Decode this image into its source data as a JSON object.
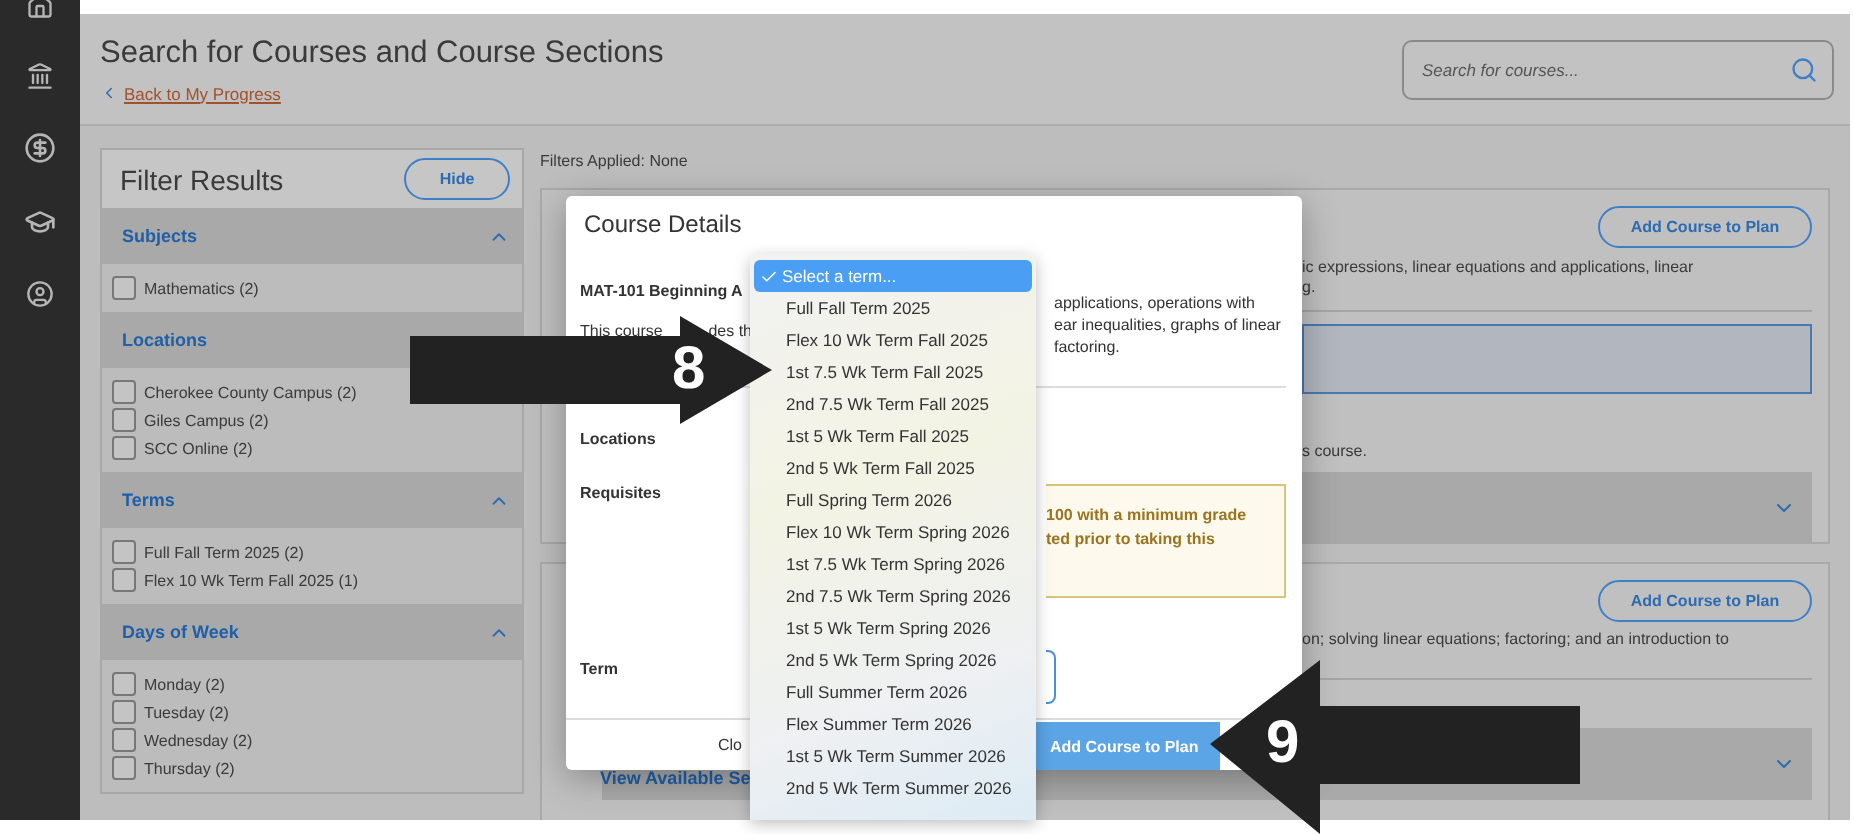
{
  "header": {
    "title": "Search for Courses and Course Sections",
    "back_link": "Back to My Progress",
    "search": {
      "placeholder": "Search for courses..."
    }
  },
  "filters": {
    "title": "Filter Results",
    "hide_button": "Hide",
    "sections": [
      {
        "title": "Subjects",
        "expanded": true,
        "options": [
          {
            "label": "Mathematics (2)",
            "checked": false
          }
        ]
      },
      {
        "title": "Locations",
        "options": [
          {
            "label": "Cherokee County Campus (2)",
            "checked": false
          },
          {
            "label": "Giles Campus (2)",
            "checked": false
          },
          {
            "label": "SCC Online (2)",
            "checked": false
          }
        ]
      },
      {
        "title": "Terms",
        "expanded": true,
        "options": [
          {
            "label": "Full Fall Term 2025 (2)",
            "checked": false
          },
          {
            "label": "Flex 10 Wk Term Fall 2025 (1)",
            "checked": false
          }
        ]
      },
      {
        "title": "Days of Week",
        "expanded": true,
        "options": [
          {
            "label": "Monday (2)",
            "checked": false
          },
          {
            "label": "Tuesday (2)",
            "checked": false
          },
          {
            "label": "Wednesday (2)",
            "checked": false
          },
          {
            "label": "Thursday (2)",
            "checked": false
          }
        ]
      }
    ]
  },
  "filters_applied": "Filters Applied: None",
  "results": [
    {
      "button": "Add Course to Plan",
      "text_lines": [
        "ic expressions, linear equations and applications, linear",
        "g."
      ],
      "note": "s course."
    },
    {
      "button": "Add Course to Plan",
      "text_lines": [
        "on; solving linear equations; factoring; and an introduction to"
      ],
      "accordion_label": "View Available Se"
    }
  ],
  "modal": {
    "title": "Course Details",
    "course": "MAT-101 Beginning A",
    "description_left": [
      "This course",
      "des th"
    ],
    "description_right": [
      "applications, operations with",
      "ear inequalities, graphs of linear",
      "factoring."
    ],
    "locations_label": "Locations",
    "requisites_label": "Requisites",
    "requisite_note": [
      "100 with a minimum grade",
      "ted prior to taking this"
    ],
    "term_label": "Term",
    "close_button": "Clo",
    "add_button": "Add Course to Plan"
  },
  "term_dropdown": {
    "options": [
      {
        "label": "Select a term...",
        "selected": true
      },
      {
        "label": "Full Fall Term 2025",
        "selected": false
      },
      {
        "label": "Flex 10 Wk Term Fall 2025",
        "selected": false
      },
      {
        "label": "1st 7.5 Wk Term Fall 2025",
        "selected": false
      },
      {
        "label": "2nd 7.5 Wk Term Fall 2025",
        "selected": false
      },
      {
        "label": "1st 5 Wk Term Fall 2025",
        "selected": false
      },
      {
        "label": "2nd 5 Wk Term Fall 2025",
        "selected": false
      },
      {
        "label": "Full Spring Term 2026",
        "selected": false
      },
      {
        "label": "Flex 10 Wk Term Spring 2026",
        "selected": false
      },
      {
        "label": "1st 7.5 Wk Term Spring 2026",
        "selected": false
      },
      {
        "label": "2nd 7.5 Wk Term Spring 2026",
        "selected": false
      },
      {
        "label": "1st 5 Wk Term Spring 2026",
        "selected": false
      },
      {
        "label": "2nd 5 Wk Term Spring 2026",
        "selected": false
      },
      {
        "label": "Full Summer Term 2026",
        "selected": false
      },
      {
        "label": "Flex Summer Term 2026",
        "selected": false
      },
      {
        "label": "1st 5 Wk Term Summer 2026",
        "selected": false
      },
      {
        "label": "2nd 5 Wk Term Summer 2026",
        "selected": false
      }
    ]
  },
  "callouts": [
    {
      "label": "8"
    },
    {
      "label": "9"
    }
  ]
}
